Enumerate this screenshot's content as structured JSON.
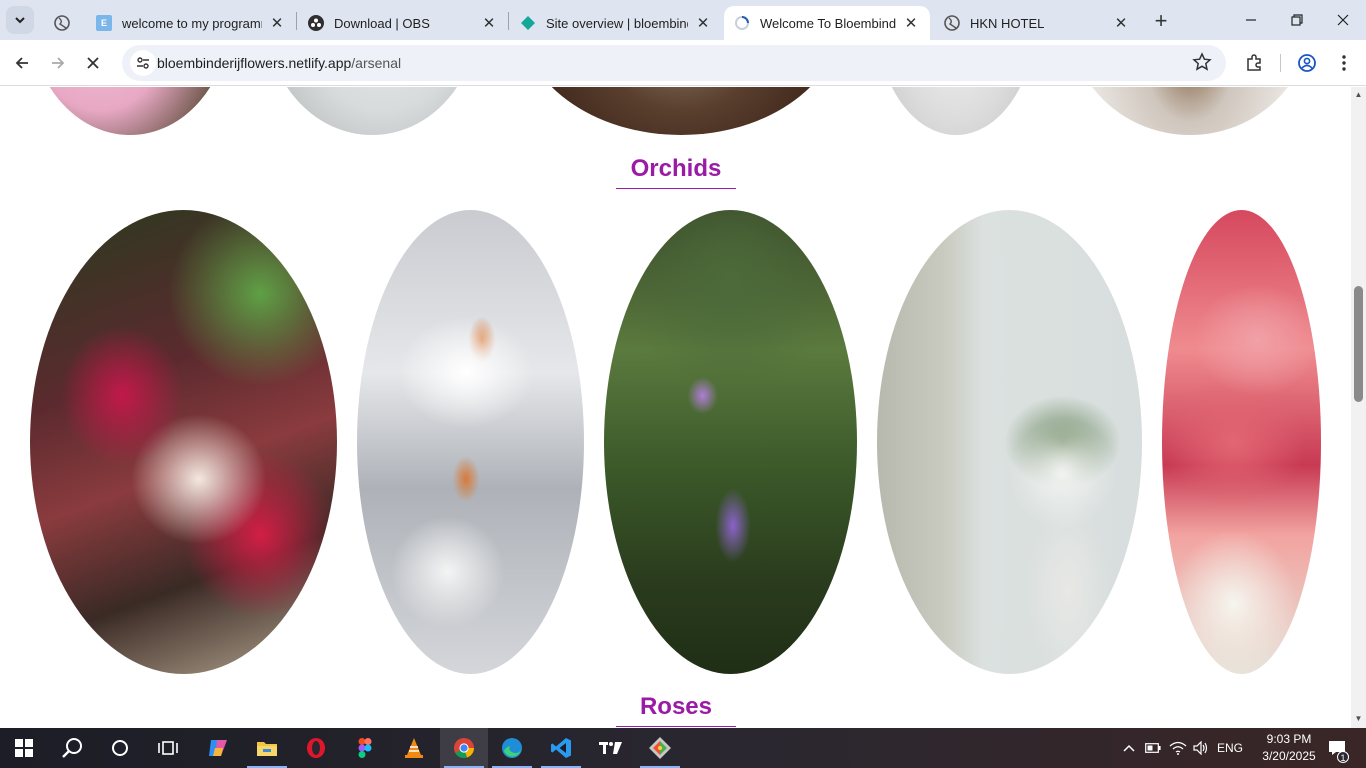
{
  "tabs": [
    {
      "title": "welcome to my programm",
      "favicon": "blog-favicon-icon",
      "active": false
    },
    {
      "title": "Download | OBS",
      "favicon": "obs-favicon-icon",
      "active": false
    },
    {
      "title": "Site overview | bloembinde",
      "favicon": "netlify-favicon-icon",
      "active": false
    },
    {
      "title": "Welcome To Bloembinderij",
      "favicon": "loading-favicon-icon",
      "active": true
    },
    {
      "title": "HKN HOTEL",
      "favicon": "globe-favicon-icon",
      "active": false
    }
  ],
  "address_bar": {
    "host": "bloembinderijflowers.netlify.app",
    "path": "/arsenal"
  },
  "page": {
    "sections": [
      {
        "heading": "Orchids"
      },
      {
        "heading": "Roses"
      }
    ]
  },
  "taskbar": {
    "apps": [
      "start",
      "search",
      "cortana",
      "task-view",
      "copilot",
      "file-explorer",
      "opera",
      "figma",
      "vlc",
      "chrome",
      "edge",
      "vscode",
      "tradingview",
      "git-gui"
    ],
    "language": "ENG",
    "time": "9:03 PM",
    "date": "3/20/2025",
    "notification_count": "1"
  },
  "colors": {
    "heading": "#9b1aa6",
    "tabstrip": "#dfe5f0",
    "omnibox": "#eef1f7"
  }
}
